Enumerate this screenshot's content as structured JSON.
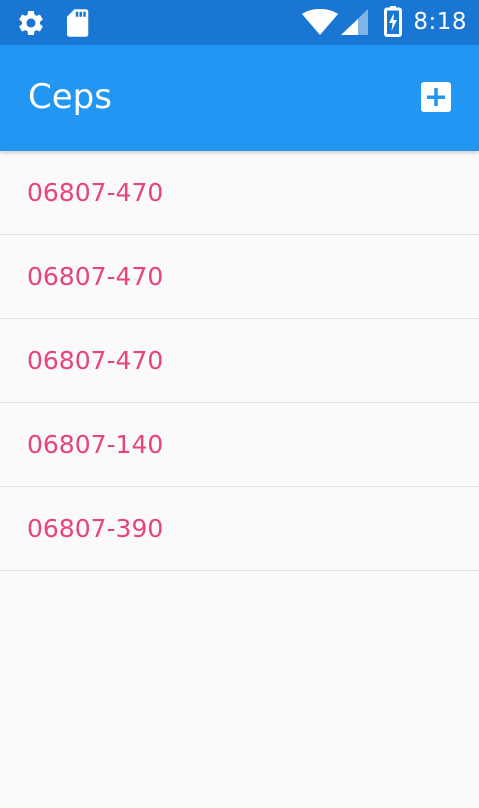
{
  "status_bar": {
    "time": "8:18",
    "icons": [
      "gear-icon",
      "sd-card-icon",
      "wifi-icon",
      "signal-icon",
      "battery-charging-icon"
    ]
  },
  "app_bar": {
    "title": "Ceps",
    "add_icon": "add-box-icon"
  },
  "ceps": [
    "06807-470",
    "06807-470",
    "06807-470",
    "06807-140",
    "06807-390"
  ],
  "colors": {
    "status_bar": "#1976d2",
    "app_bar": "#2196f3",
    "accent_text": "#e8437a",
    "background": "#fafafa",
    "divider": "#e0e0e0"
  }
}
